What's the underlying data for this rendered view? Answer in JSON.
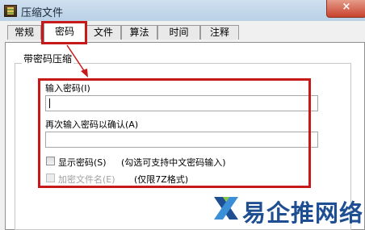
{
  "window": {
    "title": "压缩文件",
    "close_glyph": "×"
  },
  "tabs": [
    {
      "label": "常规",
      "active": false
    },
    {
      "label": "密码",
      "active": true
    },
    {
      "label": "文件",
      "active": false
    },
    {
      "label": "算法",
      "active": false
    },
    {
      "label": "时间",
      "active": false
    },
    {
      "label": "注释",
      "active": false
    }
  ],
  "group": {
    "title": "带密码压缩",
    "password_label": "输入密码(I)",
    "password_value": "",
    "confirm_label": "再次输入密码以确认(A)",
    "confirm_value": "",
    "show_password": {
      "label": "显示密码(S)",
      "checked": false,
      "note": "(勾选可支持中文密码输入)"
    },
    "encrypt_names": {
      "label": "加密文件名(E)",
      "checked": false,
      "enabled": false,
      "note": "(仅限7Z格式)"
    }
  },
  "annotation": {
    "color": "#c8191a"
  },
  "watermark": {
    "text": "易企推网络",
    "icon": "x-logo-icon"
  }
}
